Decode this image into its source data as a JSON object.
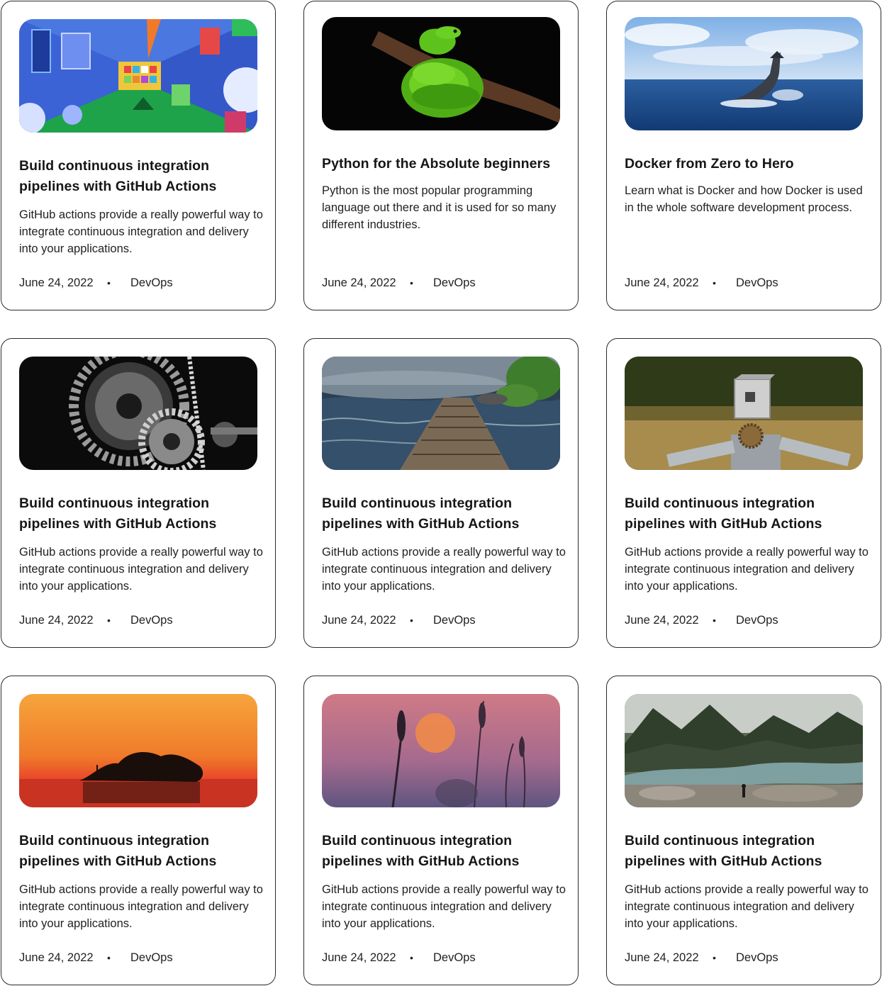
{
  "cards": [
    {
      "image": "github-actions-hallway-illustration",
      "title": "Build continuous integration pipelines with GitHub Actions",
      "description": "GitHub actions provide a really powerful way to integrate continuous integration and delivery into your applications.",
      "date": "June 24, 2022",
      "separator": "•",
      "category": "DevOps"
    },
    {
      "image": "green-python-snake-on-branch",
      "title": "Python for the Absolute beginners",
      "description": "Python is the most popular programming language out there and it is used for so many different industries.",
      "date": "June 24, 2022",
      "separator": "•",
      "category": "DevOps"
    },
    {
      "image": "whale-tail-in-ocean",
      "title": "Docker from Zero to Hero",
      "description": "Learn what is Docker and  how Docker is used in the whole software development process.",
      "date": "June 24, 2022",
      "separator": "•",
      "category": "DevOps"
    },
    {
      "image": "black-and-white-gears",
      "title": "Build continuous integration pipelines with GitHub Actions",
      "description": "GitHub actions provide a really powerful way to integrate continuous integration and delivery into your applications.",
      "date": "June 24, 2022",
      "separator": "•",
      "category": "DevOps"
    },
    {
      "image": "wooden-boardwalk-over-river",
      "title": "Build continuous integration pipelines with GitHub Actions",
      "description": "GitHub actions provide a really powerful way to integrate continuous integration and delivery into your applications.",
      "date": "June 24, 2022",
      "separator": "•",
      "category": "DevOps"
    },
    {
      "image": "scrap-metal-robot-in-field",
      "title": "Build continuous integration pipelines with GitHub Actions",
      "description": "GitHub actions provide a really powerful way to integrate continuous integration and delivery into your applications.",
      "date": "June 24, 2022",
      "separator": "•",
      "category": "DevOps"
    },
    {
      "image": "sunset-island-trees",
      "title": "Build continuous integration pipelines with GitHub Actions",
      "description": "GitHub actions provide a really powerful way to integrate continuous integration and delivery into your applications.",
      "date": "June 24, 2022",
      "separator": "•",
      "category": "DevOps"
    },
    {
      "image": "wheat-silhouette-sunset",
      "title": "Build continuous integration pipelines with GitHub Actions",
      "description": "GitHub actions provide a really powerful way to integrate continuous integration and delivery into your applications.",
      "date": "June 24, 2022",
      "separator": "•",
      "category": "DevOps"
    },
    {
      "image": "mountain-river-forest",
      "title": "Build continuous integration pipelines with GitHub Actions",
      "description": "GitHub actions provide a really powerful way to integrate continuous integration and delivery into your applications.",
      "date": "June 24, 2022",
      "separator": "•",
      "category": "DevOps"
    }
  ]
}
